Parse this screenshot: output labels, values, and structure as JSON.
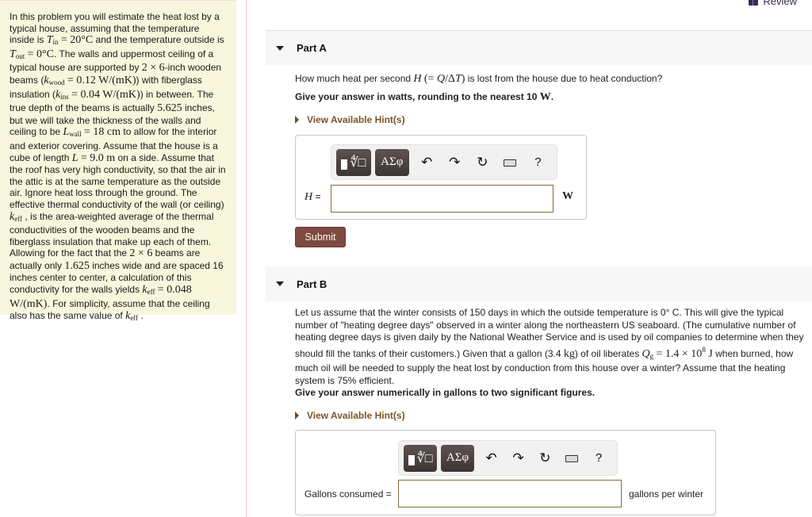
{
  "header": {
    "review_label": "Review"
  },
  "problem": {
    "segments": [
      "In this problem you will estimate the heat lost by a typical house, assuming that the temperature inside is ",
      "T_in = 20°C",
      " and the temperature outside is ",
      "T_out = 0°C",
      ". The walls and uppermost ceiling of a typical house are supported by ",
      "2 × 6",
      "-inch wooden beams (",
      "k_wood = 0.12 W/(mK)",
      ") with fiberglass insulation (",
      "k_ins = 0.04 W/(mK)",
      ") in between. The true depth of the beams is actually ",
      "5.625",
      " inches, but we will take the thickness of the walls and ceiling to be ",
      "L_wall = 18 cm",
      " to allow for the interior and exterior covering. Assume that the house is a cube of length ",
      "L = 9.0 m",
      " on a side. Assume that the roof has very high conductivity, so that the air in the attic is at the same temperature as the outside air. Ignore heat loss through the ground. The effective thermal conductivity of the wall (or ceiling) ",
      "k_eff",
      " , is the area-weighted average of the thermal conductivities of the wooden beams and the fiberglass insulation that make up each of them. Allowing for the fact that the ",
      "2 × 6",
      " beams are actually only ",
      "1.625",
      " inches wide and are spaced 16 inches center to center, a calculation of this conductivity for the walls yields ",
      "k_eff = 0.048 W/(mK)",
      ". For simplicity, assume that the ceiling also has the same value of ",
      "k_eff",
      " ."
    ]
  },
  "partA": {
    "title": "Part A",
    "question_pre": "How much heat per second ",
    "question_math": "H (= Q/ΔT)",
    "question_post": " is lost from the house due to heat conduction?",
    "instruction_pre": "Give your answer in watts, rounding to the nearest 10 ",
    "instruction_unit": "W",
    "instruction_post": ".",
    "hint_label": "View Available Hint(s)",
    "toolbar": {
      "template_root": "∜□",
      "symbols": "ΑΣφ",
      "undo": "↶",
      "redo": "↷",
      "reset": "↻",
      "help": "?"
    },
    "answer_label_var": "H",
    "answer_label_eq": " =",
    "answer_value": "",
    "unit": "W",
    "submit_label": "Submit"
  },
  "partB": {
    "title": "Part B",
    "question_1": "Let us assume that the winter consists of 150 days in which the outside temperature is 0° C. This will give the typical number of \"heating degree days\" observed in a winter along the northeastern US seaboard. (The cumulative number of heating degree days is given daily by the National Weather Service and is used by oil companies to determine when they should fill the tanks of their customers.) Given that a gallon (3.4 ",
    "question_kg": "kg",
    "question_2": ") of oil liberates ",
    "question_math": "Q_g = 1.4 × 10^8 J",
    "question_3": " when burned, how much oil will be needed to supply the heat lost by conduction from this house over a winter? Assume that the heating system is 75% efficient.",
    "instruction": "Give your answer numerically in gallons to two significant figures.",
    "hint_label": "View Available Hint(s)",
    "toolbar": {
      "template_root": "∜□",
      "symbols": "ΑΣφ",
      "undo": "↶",
      "redo": "↷",
      "reset": "↻",
      "help": "?"
    },
    "answer_label": "Gallons consumed =",
    "answer_value": "",
    "unit": "gallons per winter"
  },
  "colors": {
    "problem_bg": "#f8f6dc",
    "hint_link": "#7a5526",
    "submit_bg": "#7d4a42",
    "input_border": "#8b6a3a"
  }
}
